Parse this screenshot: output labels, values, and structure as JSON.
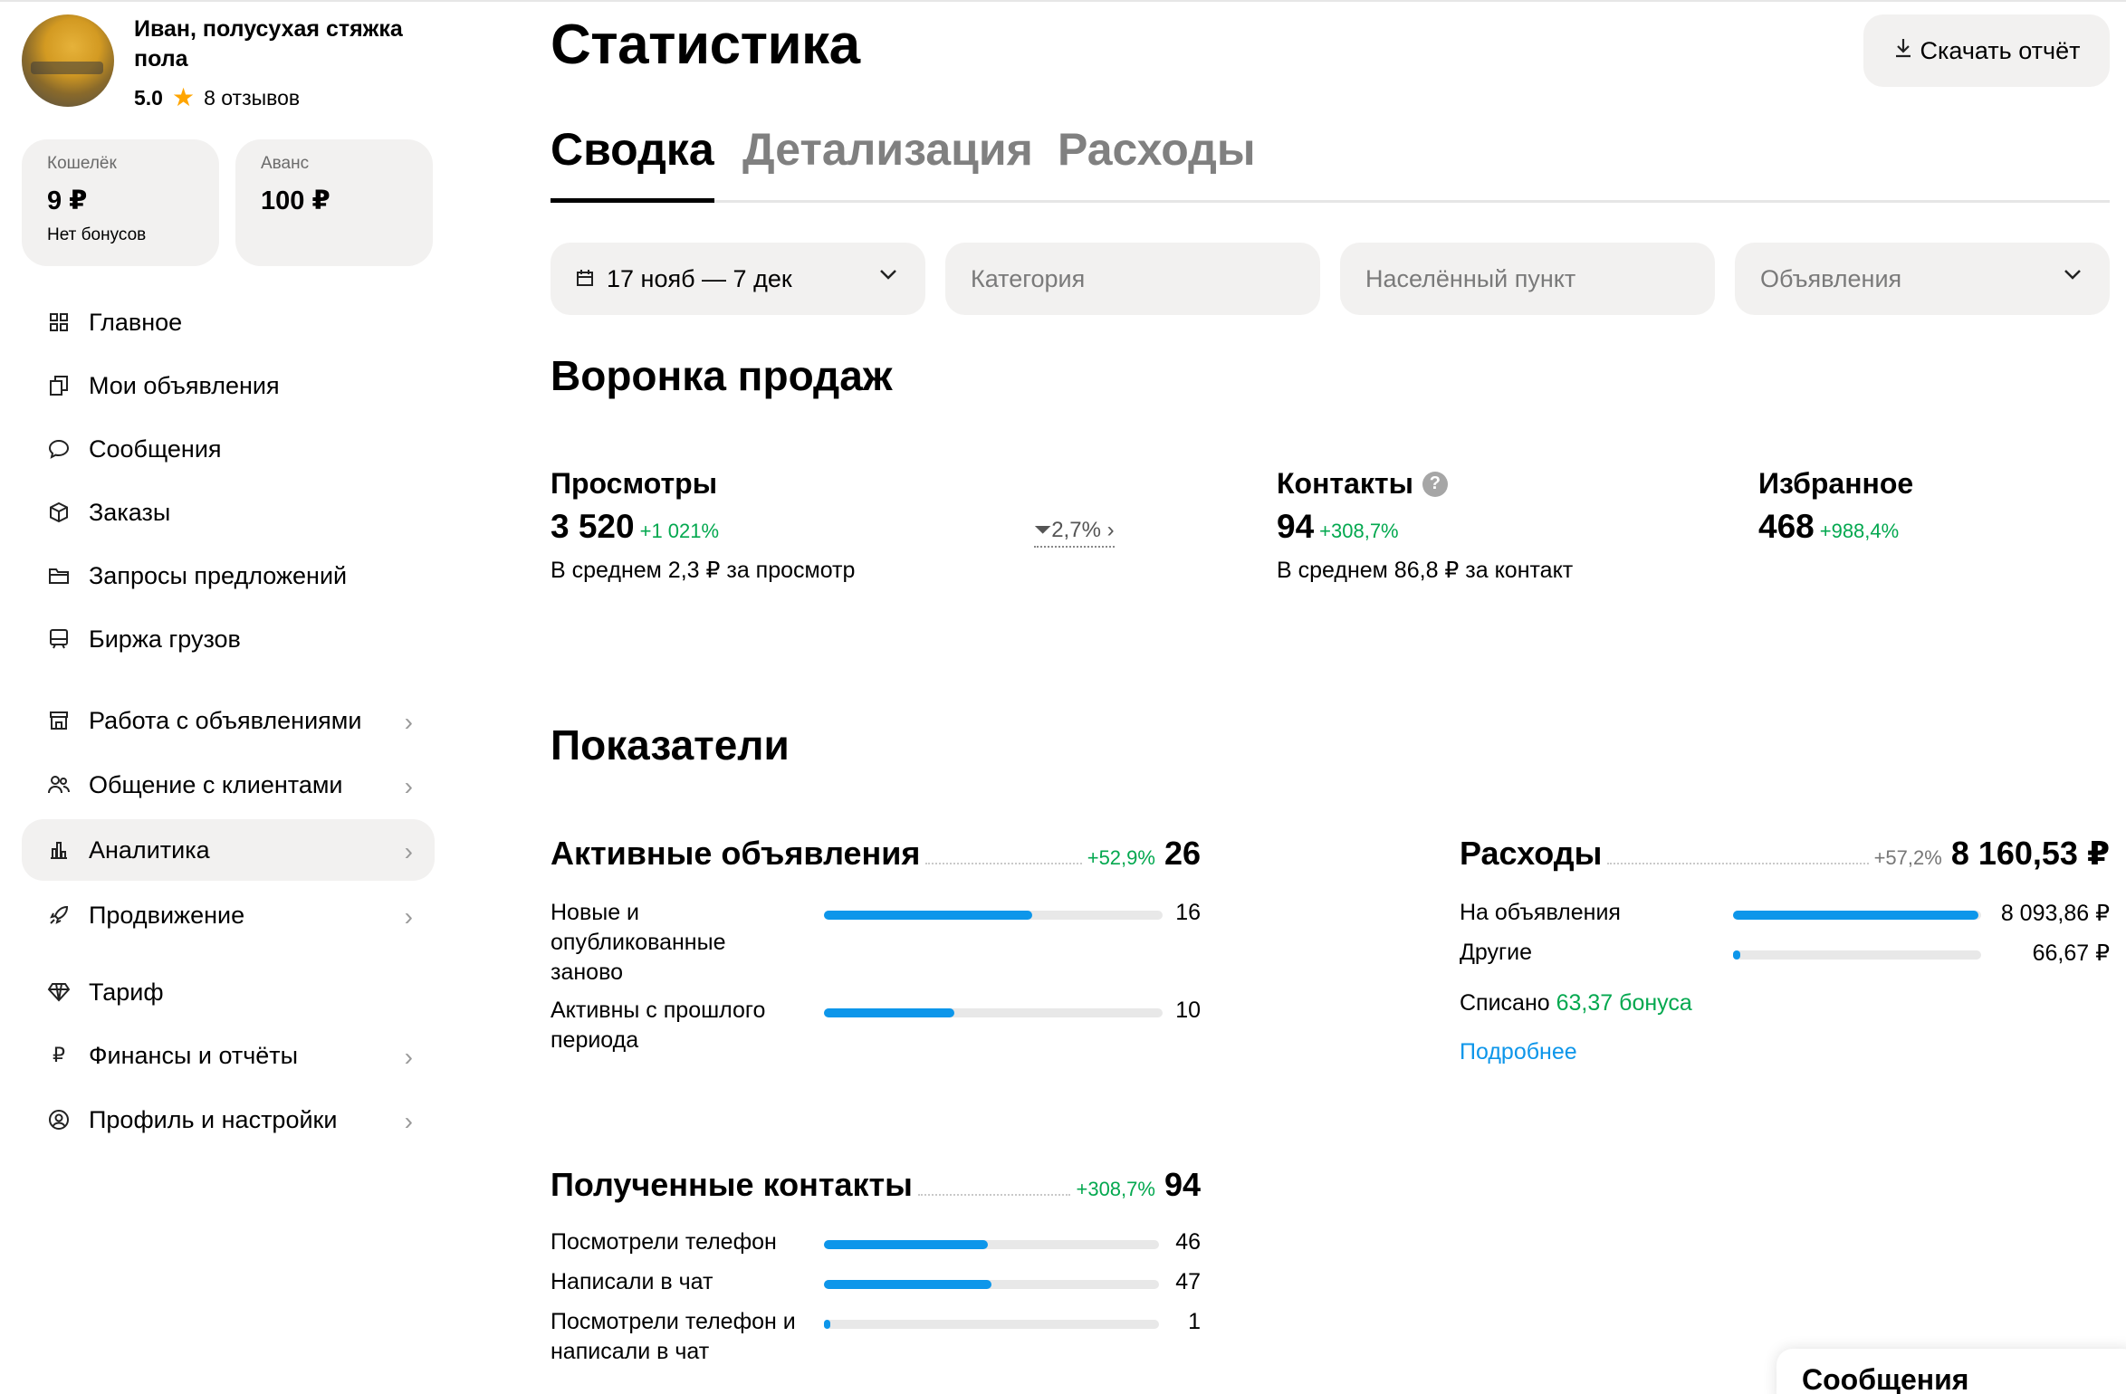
{
  "profile": {
    "name": "Иван, полусухая стяжка пола",
    "rating": "5.0",
    "reviews": "8 отзывов"
  },
  "wallets": [
    {
      "label": "Кошелёк",
      "amount": "9 ₽",
      "sub": "Нет бонусов"
    },
    {
      "label": "Аванс",
      "amount": "100 ₽",
      "sub": ""
    }
  ],
  "nav": [
    {
      "label": "Главное",
      "icon": "grid-icon"
    },
    {
      "label": "Мои объявления",
      "icon": "copy-icon"
    },
    {
      "label": "Сообщения",
      "icon": "chat-bubble-icon"
    },
    {
      "label": "Заказы",
      "icon": "box-icon"
    },
    {
      "label": "Запросы предложений",
      "icon": "folder-icon"
    },
    {
      "label": "Биржа грузов",
      "icon": "truck-icon"
    },
    {
      "label": "Работа с объявлениями",
      "icon": "store-icon"
    },
    {
      "label": "Общение с клиентами",
      "icon": "users-icon"
    },
    {
      "label": "Аналитика",
      "icon": "bar-chart-icon"
    },
    {
      "label": "Продвижение",
      "icon": "rocket-icon"
    },
    {
      "label": "Тариф",
      "icon": "diamond-icon"
    },
    {
      "label": "Финансы и отчёты",
      "icon": "ruble-icon"
    },
    {
      "label": "Профиль и настройки",
      "icon": "user-circle-icon"
    }
  ],
  "page": {
    "title": "Статистика",
    "download": "Скачать отчёт"
  },
  "tabs": [
    "Сводка",
    "Детализация",
    "Расходы"
  ],
  "filters": {
    "date": "17 нояб — 7 дек",
    "category": "Категория",
    "city": "Населённый пункт",
    "ads": "Объявления"
  },
  "funnel": {
    "title": "Воронка продаж",
    "views": {
      "title": "Просмотры",
      "value": "3 520",
      "pct": "+1 021%",
      "avg": "В среднем 2,3 ₽ за просмотр",
      "conv": "2,7%"
    },
    "contacts": {
      "title": "Контакты",
      "value": "94",
      "pct": "+308,7%",
      "avg": "В среднем 86,8 ₽ за контакт"
    },
    "favorites": {
      "title": "Избранное",
      "value": "468",
      "pct": "+988,4%"
    }
  },
  "indicators": {
    "title": "Показатели",
    "active": {
      "title": "Активные объявления",
      "pct": "+52,9%",
      "value": "26",
      "rows": [
        {
          "label": "Новые и опубликованные заново",
          "value": "16",
          "fraction": 0.615
        },
        {
          "label": "Активны с прошлого периода",
          "value": "10",
          "fraction": 0.385
        }
      ]
    },
    "expenses": {
      "title": "Расходы",
      "pct": "+57,2%",
      "value": "8 160,53 ₽",
      "rows": [
        {
          "label": "На объявления",
          "value": "8 093,86 ₽",
          "fraction": 0.99
        },
        {
          "label": "Другие",
          "value": "66,67 ₽",
          "fraction": 0.03
        }
      ],
      "written_prefix": "Списано ",
      "written_bonus": "63,37 бонуса",
      "more": "Подробнее"
    },
    "contacts": {
      "title": "Полученные контакты",
      "pct": "+308,7%",
      "value": "94",
      "rows": [
        {
          "label": "Посмотрели телефон",
          "value": "46",
          "fraction": 0.49
        },
        {
          "label": "Написали в чат",
          "value": "47",
          "fraction": 0.5
        },
        {
          "label": "Посмотрели телефон и написали в чат",
          "value": "1",
          "fraction": 0.02
        }
      ]
    }
  },
  "messages_panel": "Сообщения"
}
